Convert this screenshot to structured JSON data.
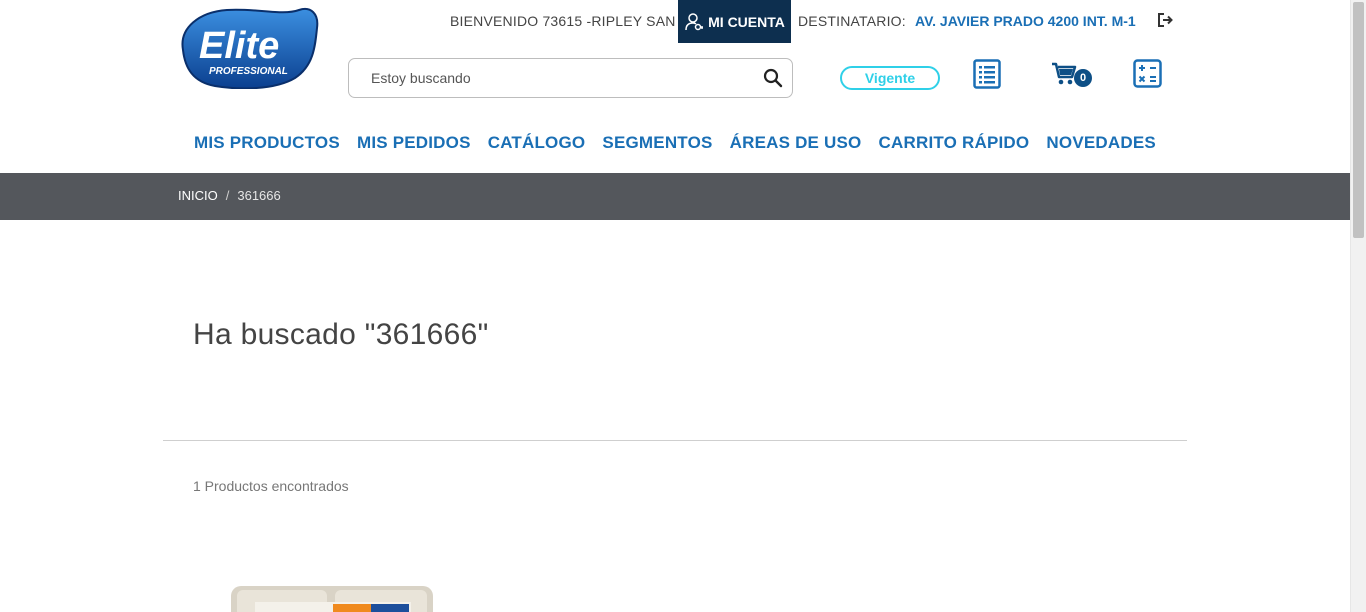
{
  "header": {
    "logo": {
      "brand": "Elite",
      "sub": "PROFESSIONAL"
    },
    "welcome_text": "BIENVENIDO 73615 -RIPLEY SAN",
    "account_label": "MI CUENTA",
    "destination_label": "DESTINATARIO:",
    "destination_value": "AV. JAVIER PRADO 4200 INT. M-1",
    "search": {
      "placeholder": "Estoy buscando",
      "value": ""
    },
    "status_label": "Vigente",
    "cart_count": "0"
  },
  "nav": {
    "items": [
      {
        "label": "MIS PRODUCTOS"
      },
      {
        "label": "MIS PEDIDOS"
      },
      {
        "label": "CATÁLOGO"
      },
      {
        "label": "SEGMENTOS"
      },
      {
        "label": "ÁREAS DE USO"
      },
      {
        "label": "CARRITO RÁPIDO"
      },
      {
        "label": "NOVEDADES"
      }
    ]
  },
  "breadcrumb": {
    "home": "INICIO",
    "separator": "/",
    "current": "361666"
  },
  "results": {
    "heading": "Ha buscado \"361666\"",
    "count_text": "1 Productos encontrados"
  },
  "colors": {
    "brand_blue": "#1a6fb5",
    "navy": "#0d2f4f",
    "status_cyan": "#2fd0e8",
    "breadcrumb_bg": "#54575c"
  },
  "icons": {
    "account": "user-key-icon",
    "logout": "logout-icon",
    "search": "search-icon",
    "list": "list-icon",
    "cart": "cart-icon",
    "calculator": "calculator-icon"
  }
}
